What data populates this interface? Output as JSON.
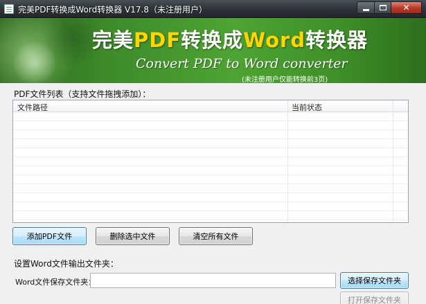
{
  "window": {
    "title": "完美PDF转换成Word转换器 V17.8（未注册用户）",
    "close_glyph": "✕"
  },
  "banner": {
    "title_a": "完美",
    "title_b": "PDF",
    "title_c": "转换成",
    "title_d": "Word",
    "title_e": "转换器",
    "subtitle": "Convert PDF  to Word converter",
    "note": "(未注册用户仅能转换前3页)"
  },
  "file_list": {
    "section_title": "PDF文件列表（支持文件拖拽添加）：",
    "columns": [
      "文件路径",
      "当前状态"
    ],
    "rows": []
  },
  "actions": {
    "add_pdf": "添加PDF文件",
    "delete_selected": "删除选中文件",
    "clear_all": "清空所有文件"
  },
  "output": {
    "section_title": "设置Word文件输出文件夹：",
    "folder_label": "Word文件保存文件夹：",
    "folder_value": "",
    "choose_folder": "选择保存文件夹",
    "open_folder": "打开保存文件夹"
  }
}
